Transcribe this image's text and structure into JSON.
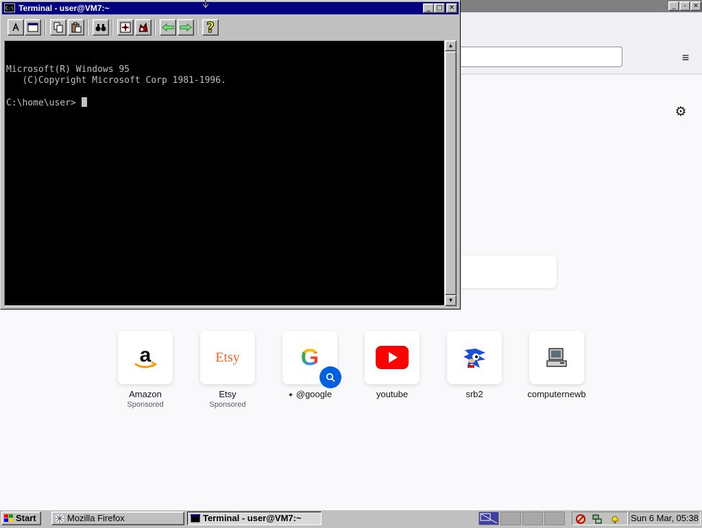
{
  "firefox": {
    "menu_icon": "hamburger-menu-icon",
    "settings_icon": "gear-icon",
    "shortcuts": [
      {
        "label": "Amazon",
        "sponsor": "Sponsored",
        "icon": "amazon-logo-icon"
      },
      {
        "label": "Etsy",
        "sponsor": "Sponsored",
        "icon": "etsy-logo-icon",
        "logo_text": "Etsy"
      },
      {
        "label": "@google",
        "sponsor": "",
        "icon": "google-logo-icon",
        "logo_text": "G"
      },
      {
        "label": "youtube",
        "sponsor": "",
        "icon": "youtube-logo-icon"
      },
      {
        "label": "srb2",
        "sponsor": "",
        "icon": "sonic-icon"
      },
      {
        "label": "computernewb",
        "sponsor": "",
        "icon": "computer-icon"
      }
    ],
    "pin_icon": "pin-icon"
  },
  "terminal": {
    "title": "Terminal - user@VM7:~",
    "title_icon_text": "C:\\",
    "lines": [
      "Microsoft(R) Windows 95",
      "   (C)Copyright Microsoft Corp 1981-1996.",
      "",
      "C:\\home\\user> "
    ],
    "toolbar_icons": [
      "mark-icon",
      "fullscreen-icon",
      "copy-icon",
      "paste-icon",
      "find-icon",
      "properties-icon",
      "background-icon",
      "back-arrow-icon",
      "forward-arrow-icon",
      "help-icon"
    ]
  },
  "taskbar": {
    "start_label": "Start",
    "tasks": [
      {
        "label": "Mozilla Firefox",
        "active": false
      },
      {
        "label": "Terminal - user@VM7:~",
        "active": true
      }
    ],
    "clock": "Sun  6 Mar, 05:38"
  },
  "colors": {
    "titlebar_active": "#000080",
    "titlebar_inactive": "#808080",
    "terminal_bg": "#000000",
    "terminal_fg": "#c0c0c0",
    "youtube_red": "#ff0000",
    "etsy_orange": "#f1641e",
    "google_blue": "#4285f4"
  }
}
